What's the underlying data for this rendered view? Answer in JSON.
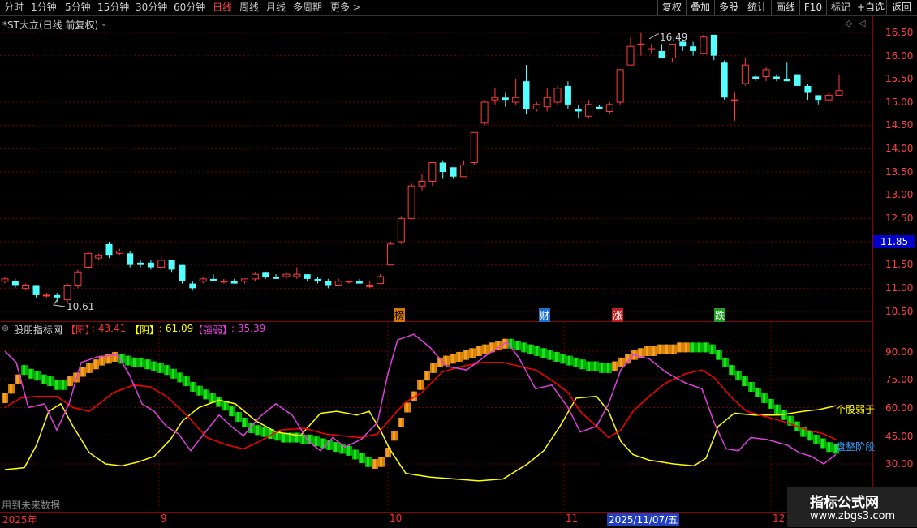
{
  "toolbar": {
    "periods": [
      "分时",
      "1分钟",
      "5分钟",
      "15分钟",
      "30分钟",
      "60分钟",
      "日线",
      "周线",
      "月线",
      "多周期",
      "更多"
    ],
    "active": "日线",
    "buttons": [
      "复权",
      "叠加",
      "多股",
      "统计",
      "画线",
      "F10",
      "标记",
      "+自选",
      "返回"
    ]
  },
  "main_title": "*ST大立(日线 前复权)",
  "price_high_label": "16.49",
  "price_low_label": "10.61",
  "price_axis": [
    "16.50",
    "16.00",
    "15.50",
    "15.00",
    "14.50",
    "14.00",
    "13.50",
    "13.00",
    "12.50",
    "12.00",
    "11.50",
    "11.00",
    "10.50"
  ],
  "current_price": "11.85",
  "event_tags": [
    {
      "text": "榜",
      "color": "#d87a00"
    },
    {
      "text": "财",
      "color": "#3aa0ff"
    },
    {
      "text": "涨",
      "color": "#ff3030"
    },
    {
      "text": "跌",
      "color": "#30c030"
    }
  ],
  "indicator": {
    "name": "股朋指标网",
    "yang_label": "【阳】",
    "yang_value": ": 43.41",
    "yin_label": "【阴】",
    "yin_value": ": 61.09",
    "qr_label": "【强弱】",
    "qr_value": ": 35.39",
    "axis": [
      "90.00",
      "75.00",
      "60.00",
      "45.00",
      "30.00"
    ],
    "annot_yellow": "个股弱于",
    "annot_blue": "盘整阶段",
    "future_note": "用到未来数据"
  },
  "date_axis": [
    "2025年",
    "9",
    "10",
    "11",
    "2025/11/07/五",
    "12"
  ],
  "watermark": {
    "title": "指标公式网",
    "url": "www.zbgs3.com"
  },
  "colors": {
    "up": "#ff3c3c",
    "down": "#54ffff",
    "red_line": "#ff0000",
    "yellow_line": "#ffff00",
    "magenta_line": "#e040e0",
    "green": "#00b000",
    "orange": "#d88000"
  },
  "chart_data": {
    "type": "candlestick",
    "ylim": [
      10.4,
      16.7
    ],
    "candles": [
      [
        11.15,
        11.2,
        11.25,
        11.1
      ],
      [
        11.15,
        11.05,
        11.2,
        11.0
      ],
      [
        11.0,
        11.05,
        11.1,
        10.95
      ],
      [
        11.05,
        10.85,
        11.05,
        10.8
      ],
      [
        10.85,
        10.85,
        10.9,
        10.8
      ],
      [
        10.85,
        10.8,
        10.9,
        10.7
      ],
      [
        10.75,
        11.05,
        11.1,
        10.7
      ],
      [
        11.05,
        11.35,
        11.4,
        11.0
      ],
      [
        11.45,
        11.75,
        11.8,
        11.4
      ],
      [
        11.65,
        11.7,
        11.75,
        11.6
      ],
      [
        11.95,
        11.7,
        12.0,
        11.65
      ],
      [
        11.75,
        11.8,
        11.85,
        11.7
      ],
      [
        11.75,
        11.5,
        11.8,
        11.45
      ],
      [
        11.55,
        11.5,
        11.6,
        11.45
      ],
      [
        11.55,
        11.45,
        11.6,
        11.4
      ],
      [
        11.45,
        11.6,
        11.7,
        11.4
      ],
      [
        11.6,
        11.4,
        11.6,
        11.35
      ],
      [
        11.5,
        11.15,
        11.5,
        11.1
      ],
      [
        11.1,
        11.0,
        11.15,
        10.95
      ],
      [
        11.15,
        11.2,
        11.25,
        11.1
      ],
      [
        11.2,
        11.15,
        11.3,
        11.15
      ],
      [
        11.15,
        11.15,
        11.2,
        11.1
      ],
      [
        11.15,
        11.1,
        11.2,
        11.1
      ],
      [
        11.15,
        11.2,
        11.2,
        11.1
      ],
      [
        11.2,
        11.3,
        11.35,
        11.15
      ],
      [
        11.35,
        11.25,
        11.35,
        11.2
      ],
      [
        11.25,
        11.2,
        11.3,
        11.2
      ],
      [
        11.25,
        11.3,
        11.35,
        11.2
      ],
      [
        11.25,
        11.3,
        11.45,
        11.2
      ],
      [
        11.3,
        11.2,
        11.3,
        11.15
      ],
      [
        11.2,
        11.15,
        11.25,
        11.1
      ],
      [
        11.15,
        11.05,
        11.2,
        11.0
      ],
      [
        11.05,
        11.15,
        11.2,
        11.05
      ],
      [
        11.15,
        11.15,
        11.15,
        11.1
      ],
      [
        11.15,
        11.1,
        11.2,
        11.1
      ],
      [
        11.05,
        11.05,
        11.15,
        11.0
      ],
      [
        11.1,
        11.25,
        11.3,
        11.1
      ],
      [
        11.5,
        11.95,
        12.0,
        11.5
      ],
      [
        12.0,
        12.5,
        12.55,
        11.95
      ],
      [
        12.5,
        13.2,
        13.25,
        12.5
      ],
      [
        13.2,
        13.3,
        13.45,
        13.1
      ],
      [
        13.3,
        13.7,
        13.7,
        13.2
      ],
      [
        13.7,
        13.5,
        13.75,
        13.35
      ],
      [
        13.6,
        13.4,
        13.6,
        13.35
      ],
      [
        13.4,
        13.65,
        13.75,
        13.4
      ],
      [
        13.7,
        14.35,
        14.35,
        13.65
      ],
      [
        14.55,
        15.0,
        15.05,
        14.5
      ],
      [
        15.05,
        15.1,
        15.3,
        14.95
      ],
      [
        15.1,
        15.05,
        15.2,
        14.9
      ],
      [
        15.0,
        15.1,
        15.5,
        14.95
      ],
      [
        15.45,
        14.85,
        15.8,
        14.75
      ],
      [
        14.85,
        14.95,
        15.0,
        14.8
      ],
      [
        14.9,
        15.1,
        15.3,
        14.8
      ],
      [
        15.0,
        15.3,
        15.35,
        14.95
      ],
      [
        15.35,
        14.95,
        15.45,
        14.85
      ],
      [
        14.85,
        14.8,
        14.95,
        14.65
      ],
      [
        14.7,
        14.95,
        15.05,
        14.65
      ],
      [
        14.9,
        14.85,
        14.95,
        14.85
      ],
      [
        14.8,
        14.95,
        15.0,
        14.75
      ],
      [
        15.0,
        15.7,
        15.7,
        14.95
      ],
      [
        15.8,
        16.2,
        16.4,
        15.8
      ],
      [
        16.25,
        16.25,
        16.49,
        16.0
      ],
      [
        16.15,
        16.15,
        16.25,
        16.05
      ],
      [
        16.1,
        15.95,
        16.25,
        15.95
      ],
      [
        15.95,
        16.25,
        16.25,
        15.85
      ],
      [
        16.3,
        16.2,
        16.35,
        16.1
      ],
      [
        16.2,
        16.1,
        16.3,
        16.0
      ],
      [
        16.05,
        16.4,
        16.45,
        16.05
      ],
      [
        16.45,
        16.0,
        16.45,
        15.9
      ],
      [
        15.85,
        15.1,
        15.9,
        15.05
      ],
      [
        15.05,
        15.05,
        15.2,
        14.6
      ],
      [
        15.4,
        15.8,
        15.95,
        15.35
      ],
      [
        15.55,
        15.5,
        15.6,
        15.45
      ],
      [
        15.55,
        15.7,
        15.75,
        15.45
      ],
      [
        15.55,
        15.5,
        15.6,
        15.45
      ],
      [
        15.5,
        15.45,
        15.85,
        15.45
      ],
      [
        15.6,
        15.35,
        15.6,
        15.35
      ],
      [
        15.35,
        15.2,
        15.4,
        15.05
      ],
      [
        15.15,
        15.05,
        15.15,
        14.95
      ],
      [
        15.05,
        15.15,
        15.2,
        15.05
      ],
      [
        15.15,
        15.25,
        15.6,
        15.15
      ]
    ]
  }
}
